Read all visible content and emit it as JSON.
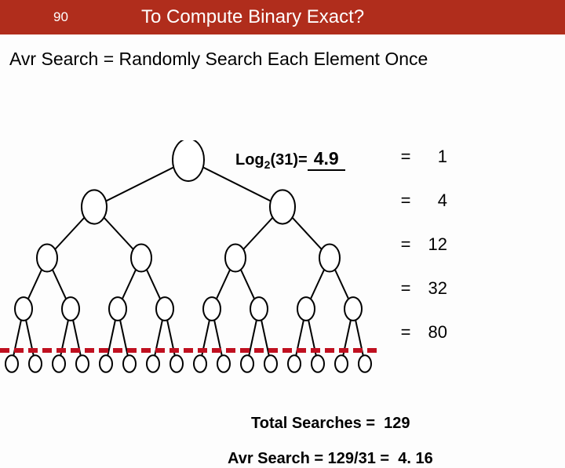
{
  "header": {
    "slide_number": "90",
    "title": "To Compute Binary Exact?"
  },
  "subtitle": "Avr Search = Randomly Search Each Element Once",
  "log": {
    "prefix": "Log",
    "sub": "2",
    "arg": "(31)=",
    "value": "4.9"
  },
  "rows": [
    {
      "eq": "=",
      "val": "1"
    },
    {
      "eq": "=",
      "val": "4"
    },
    {
      "eq": "=",
      "val": "12"
    },
    {
      "eq": "=",
      "val": "32"
    },
    {
      "eq": "=",
      "val": "80"
    }
  ],
  "total_label": "Total Searches =",
  "total_value": "129",
  "avr_label": "Avr Search = 129/31 =",
  "avr_value": "4. 16",
  "chart_data": {
    "type": "diagram",
    "description": "Full binary tree with 5 levels (31 nodes). A dashed horizontal line separates levels 4 and 5.",
    "levels": 5,
    "total_nodes": 31,
    "nodes_per_level": [
      1,
      2,
      4,
      8,
      16
    ],
    "search_cost_per_level": [
      1,
      4,
      12,
      32,
      80
    ],
    "total_searches": 129,
    "average_search": 4.16,
    "log2_of_nodes": 4.9
  }
}
